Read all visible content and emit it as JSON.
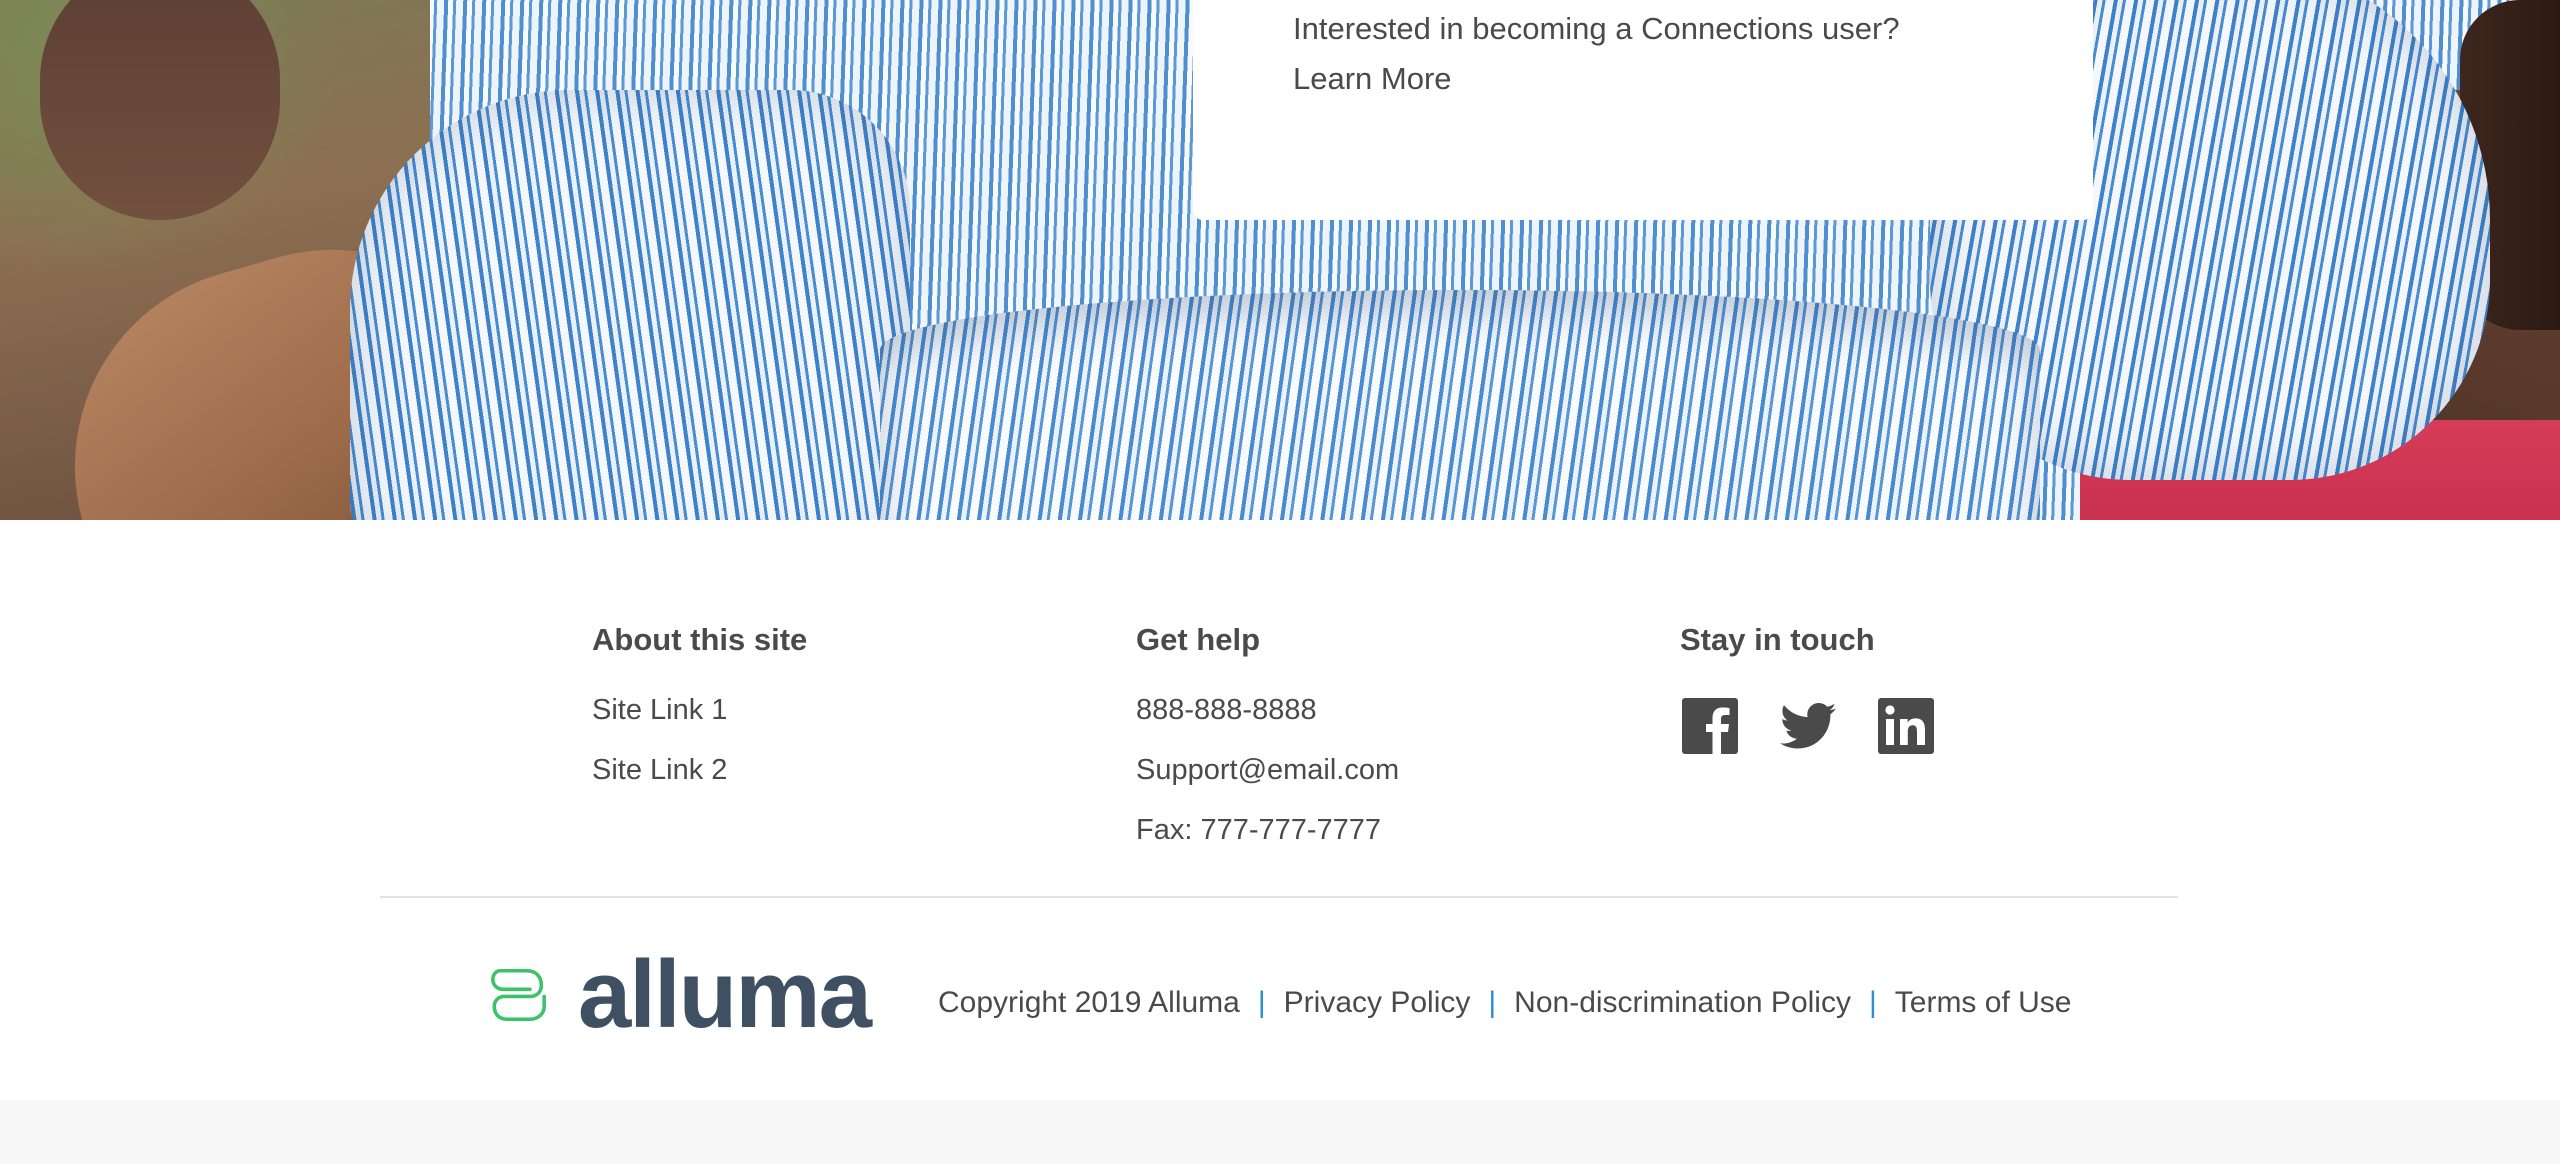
{
  "hero": {
    "card": {
      "prompt": "Interested in becoming a Connections user?",
      "link_label": "Learn More"
    }
  },
  "footer": {
    "about": {
      "heading": "About this site",
      "links": [
        "Site Link 1",
        "Site Link 2"
      ]
    },
    "help": {
      "heading": "Get help",
      "items": [
        "888-888-8888",
        "Support@email.com",
        "Fax: 777-777-7777"
      ]
    },
    "touch": {
      "heading": "Stay in touch",
      "icons": [
        "facebook-icon",
        "twitter-icon",
        "linkedin-icon"
      ]
    },
    "logo": {
      "wordmark": "alluma",
      "mark_color": "#3cc26b",
      "wordmark_color": "#3e5061"
    },
    "legal": {
      "copyright": "Copyright 2019 Alluma",
      "separator": "|",
      "links": [
        "Privacy Policy",
        "Non-discrimination Policy",
        "Terms of Use"
      ]
    }
  },
  "colors": {
    "text": "#4a4a4a",
    "separator": "#2a8fd6",
    "icon": "#4a4a4a"
  }
}
